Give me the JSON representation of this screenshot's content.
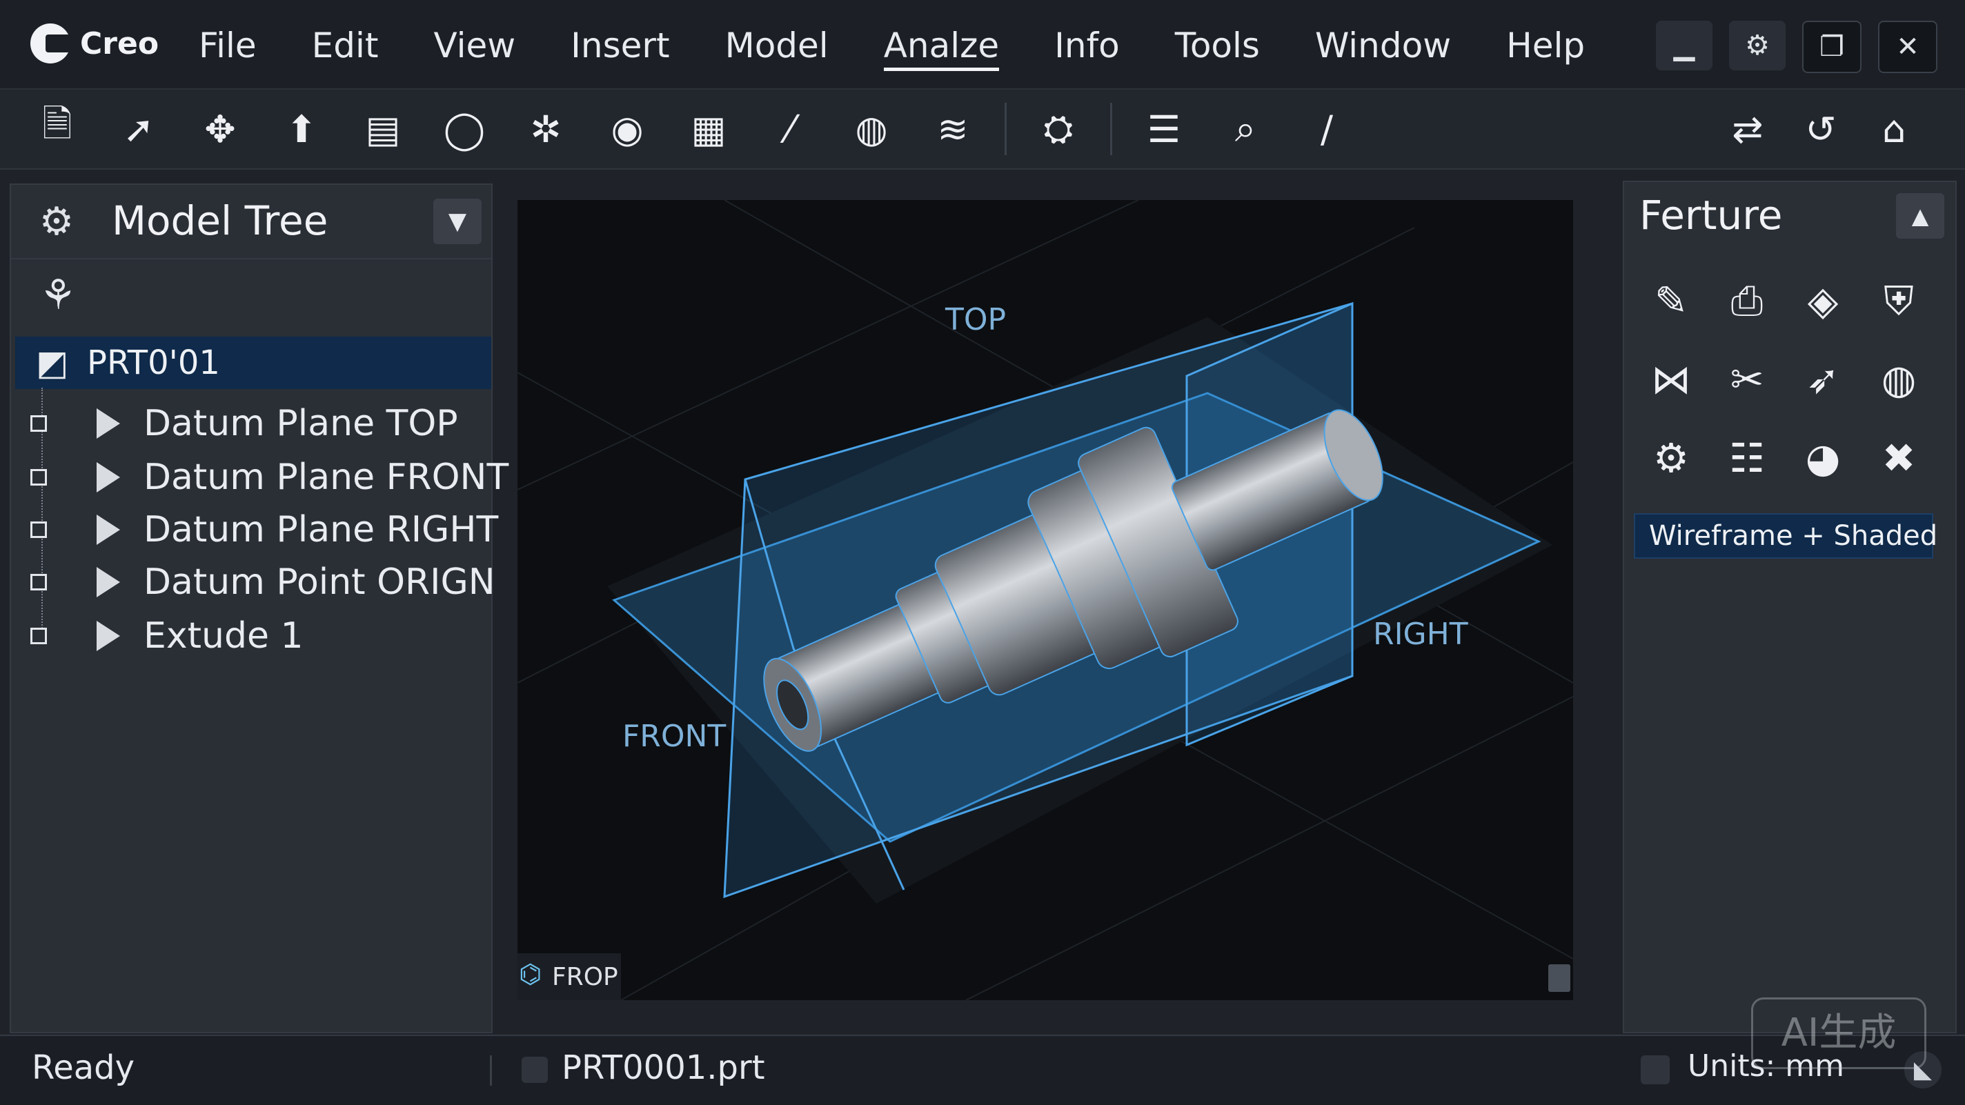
{
  "app": {
    "logo_text": "Creo"
  },
  "menu": [
    "File",
    "Edit",
    "View",
    "Insert",
    "Model",
    "Analze",
    "Info",
    "Tools",
    "Window",
    "Help"
  ],
  "menu_active": "Analze",
  "window_buttons": [
    "minimize-icon",
    "settings-icon",
    "restore-icon",
    "close-icon"
  ],
  "toolbar_icons": [
    "save-icon",
    "sketch-icon",
    "datum-icon",
    "extrude-icon",
    "revolve-icon",
    "sweep-icon",
    "blend-icon",
    "hole-icon",
    "shell-icon",
    "rib-icon",
    "measure-icon",
    "render-icon",
    "pattern-icon",
    "view-manager-icon",
    "layer-icon",
    "zoom-icon",
    "pen-icon"
  ],
  "toolbar_right_icons": [
    "regenerate-icon",
    "undo-redo-icon",
    "home-icon"
  ],
  "model_tree": {
    "title": "Model Tree",
    "root": "PRT0'01",
    "items": [
      {
        "label": "Datum Plane TOP"
      },
      {
        "label": "Datum Plane FRONT"
      },
      {
        "label": "Datum Plane RIGHT"
      },
      {
        "label": "Datum Point ORIGN"
      },
      {
        "label": "Extude 1"
      }
    ]
  },
  "viewport": {
    "labels": {
      "top": "TOP",
      "front": "FRONT",
      "right": "RIGHT"
    },
    "view_name": "FROP",
    "plane_color": "#2f83c7",
    "part_color": "#8e939a"
  },
  "feature_panel": {
    "title": "Ferture",
    "icons": [
      "edit-feature-icon",
      "print-icon",
      "eraser-icon",
      "shield-icon",
      "mesh-icon",
      "crossed-tools-icon",
      "arrow-icon",
      "globe-icon",
      "gear-assembly-icon",
      "notes-icon",
      "pie-icon",
      "wrench-icon"
    ],
    "display_mode": "Wireframe + Shaded"
  },
  "status": {
    "ready": "Ready",
    "file": "PRT0001.prt",
    "units": "Units: mm"
  },
  "watermark": "AI生成"
}
